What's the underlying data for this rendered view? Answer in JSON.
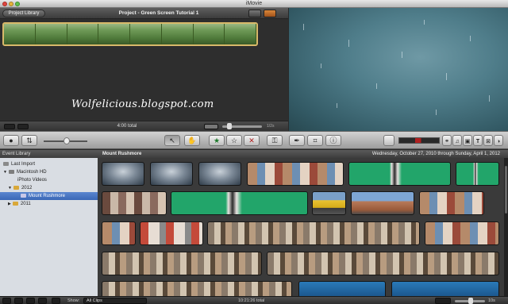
{
  "window": {
    "title": "iMovie"
  },
  "project": {
    "library_button": "Project Library",
    "title": "Project - Green Screen Tutorial 1",
    "total": "4:00 total",
    "zoom_value": "1/2s"
  },
  "watermark": "Wolfelicious.blogspot.com",
  "event_library": {
    "header": "Event Library",
    "items": [
      {
        "label": "Last Import"
      },
      {
        "label": "Macintosh HD"
      },
      {
        "label": "iPhoto Videos"
      },
      {
        "label": "2012"
      },
      {
        "label": "Mount Rushmore"
      },
      {
        "label": "2011"
      }
    ]
  },
  "browser": {
    "event_name": "Mount Rushmore",
    "date_range": "Wednesday, October 27, 2010 through Sunday, April 1, 2012"
  },
  "bottom_bar": {
    "show_label": "Show:",
    "show_value": "All Clips",
    "duration": "10:21:26 total",
    "zoom_value": "10s"
  },
  "colors": {
    "accent_selected": "#3a67b6",
    "project_border": "#d8b96a",
    "green_screen": "#22a56a"
  },
  "icons": {
    "toolbar": [
      "camera-icon",
      "swap-icon",
      "select-arrow-icon",
      "hand-tool-icon",
      "favorite-star-icon",
      "unmark-star-icon",
      "reject-x-icon",
      "keyword-icon",
      "dropper-icon",
      "crop-icon",
      "info-icon",
      "voiceover-mic-icon",
      "music-note-icon",
      "photo-camera-icon",
      "title-text-icon",
      "transitions-icon",
      "maps-icon"
    ]
  }
}
